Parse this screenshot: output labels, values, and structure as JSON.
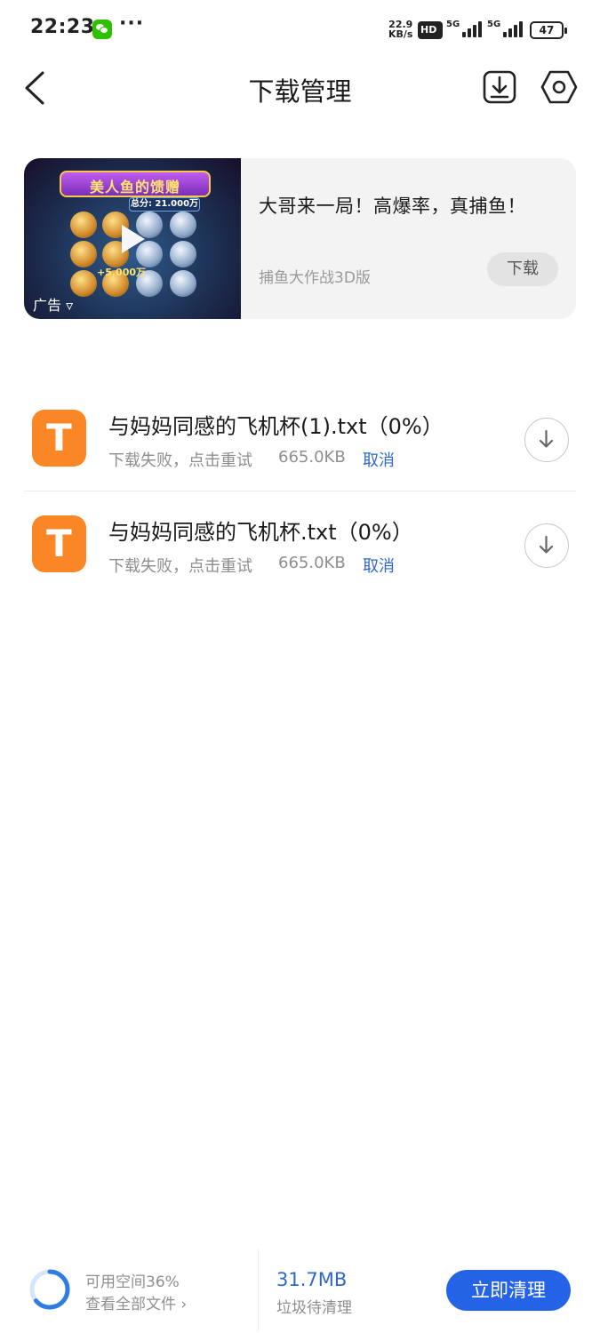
{
  "status_bar": {
    "time": "22:23",
    "more": "···",
    "net_speed_value": "22.9",
    "net_speed_unit": "KB/s",
    "hd_label": "HD",
    "signal1_label": "5G",
    "signal2_label": "5G",
    "battery": "47",
    "icons": [
      "wechat-icon",
      "signal-icon",
      "battery-icon"
    ]
  },
  "header": {
    "title": "下载管理",
    "icons": [
      "back-arrow-icon",
      "download-icon",
      "settings-icon"
    ]
  },
  "ad": {
    "banner_text": "美人鱼的馈赠",
    "score_text": "总分: 21.000万",
    "multiplier_text": "+5,000万",
    "label": "广告 ▿",
    "headline": "大哥来一局！高爆率，真捕鱼！",
    "source": "捕鱼大作战3D版",
    "download_label": "下载"
  },
  "downloads": [
    {
      "icon_letter": "T",
      "name": "与妈妈同感的飞机杯(1).txt（0%）",
      "status": "下载失败，点击重试",
      "size": "665.0KB",
      "cancel_label": "取消"
    },
    {
      "icon_letter": "T",
      "name": "与妈妈同感的飞机杯.txt（0%）",
      "status": "下载失败，点击重试",
      "size": "665.0KB",
      "cancel_label": "取消"
    }
  ],
  "bottom": {
    "storage_available": "可用空间36%",
    "storage_fraction_available": 0.36,
    "view_all": "查看全部文件 ›",
    "junk_size": "31.7MB",
    "junk_label": "垃圾待清理",
    "clean_button": "立即清理"
  },
  "colors": {
    "accent": "#2463e6",
    "link": "#2f68c3",
    "file_icon": "#fb8625",
    "ring": "#2f7de0",
    "ring_track": "#d6e6fa"
  }
}
